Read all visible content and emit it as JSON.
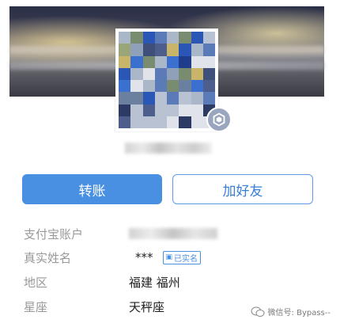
{
  "profile": {
    "buttons": {
      "transfer_label": "转账",
      "add_friend_label": "加好友"
    },
    "fields": [
      {
        "label": "支付宝账户",
        "value": ""
      },
      {
        "label": "真实姓名",
        "value": "***",
        "badge": "已实名"
      },
      {
        "label": "地区",
        "value": "福建 福州"
      },
      {
        "label": "星座",
        "value": "天秤座"
      }
    ]
  },
  "watermark": {
    "text": "微信号: Bypass--"
  },
  "colors": {
    "accent": "#4a90e2",
    "label_gray": "#999999",
    "badge_gray": "#9aa6bd"
  }
}
